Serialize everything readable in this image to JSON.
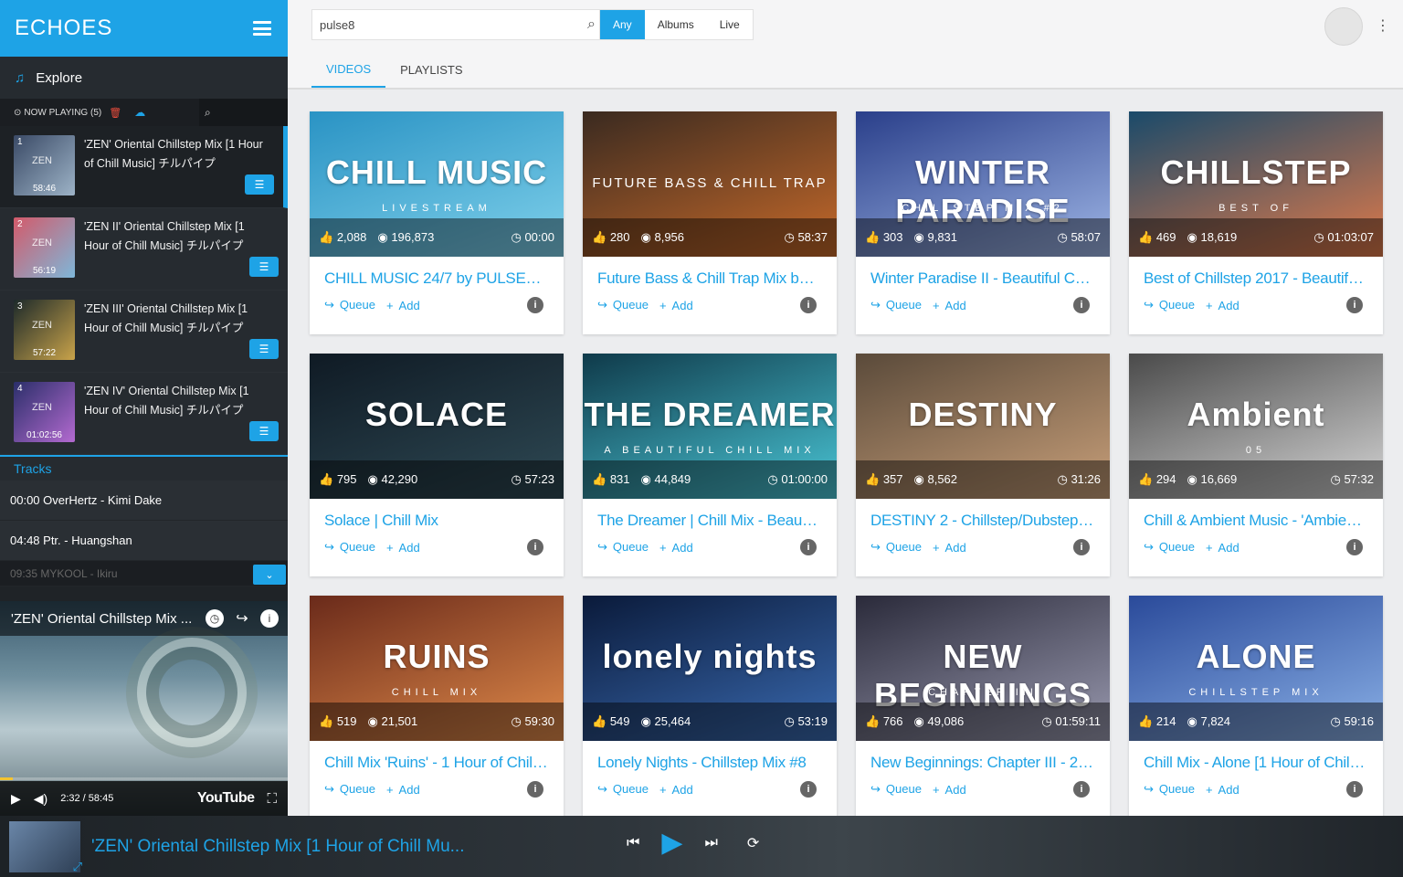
{
  "brand": {
    "logo": "ECHOES"
  },
  "sidebar": {
    "explore_label": "Explore",
    "now_playing_label": "NOW PLAYING (5)",
    "playlist": [
      {
        "num": "1",
        "duration": "58:46",
        "title": "'ZEN' Oriental Chillstep Mix [1 Hour of Chill Music] チルパイプ",
        "thumb_a": "#3a4a66",
        "thumb_b": "#9db3c7"
      },
      {
        "num": "2",
        "duration": "56:19",
        "title": "'ZEN II' Oriental Chillstep Mix [1 Hour of Chill Music] チルパイプ",
        "thumb_a": "#d35a6a",
        "thumb_b": "#7eb7d9"
      },
      {
        "num": "3",
        "duration": "57:22",
        "title": "'ZEN III' Oriental Chillstep Mix [1 Hour of Chill Music] チルパイプ",
        "thumb_a": "#1d2a2a",
        "thumb_b": "#c9a34a"
      },
      {
        "num": "4",
        "duration": "01:02:56",
        "title": "'ZEN IV' Oriental Chillstep Mix [1 Hour of Chill Music] チルパイプ",
        "thumb_a": "#2b2f6a",
        "thumb_b": "#b36ad0"
      }
    ],
    "tracks_heading": "Tracks",
    "tracks": [
      "00:00 OverHertz - Kimi Dake",
      "04:48 Ptr. - Huangshan"
    ],
    "faded_track": "09:35 MYKOOL - Ikiru"
  },
  "mini_player": {
    "title": "'ZEN' Oriental Chillstep Mix ...",
    "time": "2:32 / 58:45",
    "progress": 0.043,
    "youtube_label": "YouTube"
  },
  "header": {
    "search_value": "pulse8",
    "filters": [
      "Any",
      "Albums",
      "Live"
    ],
    "active_filter": 0,
    "tabs": [
      "VIDEOS",
      "PLAYLISTS"
    ],
    "active_tab": 0
  },
  "card_actions": {
    "queue": "Queue",
    "add": "Add"
  },
  "videos": [
    {
      "big": "CHILL MUSIC",
      "sub": "LIVESTREAM",
      "likes": "2,088",
      "views": "196,873",
      "duration": "00:00",
      "title": "CHILL MUSIC 24/7 by PULSE8 [QHD] ...",
      "c1": "#2a93c4",
      "c2": "#7fd0ea"
    },
    {
      "big": "",
      "sub": "FUTURE BASS & CHILL TRAP",
      "likes": "280",
      "views": "8,956",
      "duration": "58:37",
      "title": "Future Bass & Chill Trap Mix by Pulse...",
      "c1": "#3a2a20",
      "c2": "#c76a2a"
    },
    {
      "big": "WINTER PARADISE",
      "sub": "CHILLSTEP MIX #2",
      "likes": "303",
      "views": "9,831",
      "duration": "58:07",
      "title": "Winter Paradise II - Beautiful Chillste...",
      "c1": "#2a3f8a",
      "c2": "#9fb6e6"
    },
    {
      "big": "CHILLSTEP",
      "sub": "BEST OF",
      "likes": "469",
      "views": "18,619",
      "duration": "01:03:07",
      "title": "Best of Chillstep 2017 - Beautiful Chill...",
      "c1": "#1a4a6a",
      "c2": "#e07a4a"
    },
    {
      "big": "SOLACE",
      "sub": "",
      "likes": "795",
      "views": "42,290",
      "duration": "57:23",
      "title": "Solace | Chill Mix",
      "c1": "#0f1a24",
      "c2": "#2f4a55"
    },
    {
      "big": "THE DREAMER",
      "sub": "A BEAUTIFUL CHILL MIX",
      "likes": "831",
      "views": "44,849",
      "duration": "01:00:00",
      "title": "The Dreamer | Chill Mix - Beautiful C...",
      "c1": "#0f3a4a",
      "c2": "#4ac6d6"
    },
    {
      "big": "DESTINY",
      "sub": "",
      "likes": "357",
      "views": "8,562",
      "duration": "31:26",
      "title": "DESTINY 2 - Chillstep/Dubstep Gamin...",
      "c1": "#5a4a3a",
      "c2": "#c9a07a"
    },
    {
      "big": "Ambient",
      "sub": "05",
      "likes": "294",
      "views": "16,669",
      "duration": "57:32",
      "title": "Chill & Ambient Music - 'Ambient 05' ...",
      "c1": "#4a4a4a",
      "c2": "#d6d6d6"
    },
    {
      "big": "RUINS",
      "sub": "CHILL MIX",
      "likes": "519",
      "views": "21,501",
      "duration": "59:30",
      "title": "Chill Mix 'Ruins' - 1 Hour of Chill Out ...",
      "c1": "#6a2a1a",
      "c2": "#e08a4a"
    },
    {
      "big": "lonely nights",
      "sub": "",
      "likes": "549",
      "views": "25,464",
      "duration": "53:19",
      "title": "Lonely Nights - Chillstep Mix #8",
      "c1": "#0a1a3a",
      "c2": "#3a6ab0"
    },
    {
      "big": "NEW BEGINNINGS",
      "sub": "CHAPTER III",
      "likes": "766",
      "views": "49,086",
      "duration": "01:59:11",
      "title": "New Beginnings: Chapter III - 2 Hour ...",
      "c1": "#2a2a3a",
      "c2": "#9a9ab0"
    },
    {
      "big": "ALONE",
      "sub": "CHILLSTEP MIX",
      "likes": "214",
      "views": "7,824",
      "duration": "59:16",
      "title": "Chill Mix - Alone [1 Hour of Chill Out ...",
      "c1": "#2a4a9a",
      "c2": "#8ab0e6"
    }
  ],
  "player": {
    "title": "'ZEN' Oriental Chillstep Mix [1 Hour of Chill Mu..."
  }
}
